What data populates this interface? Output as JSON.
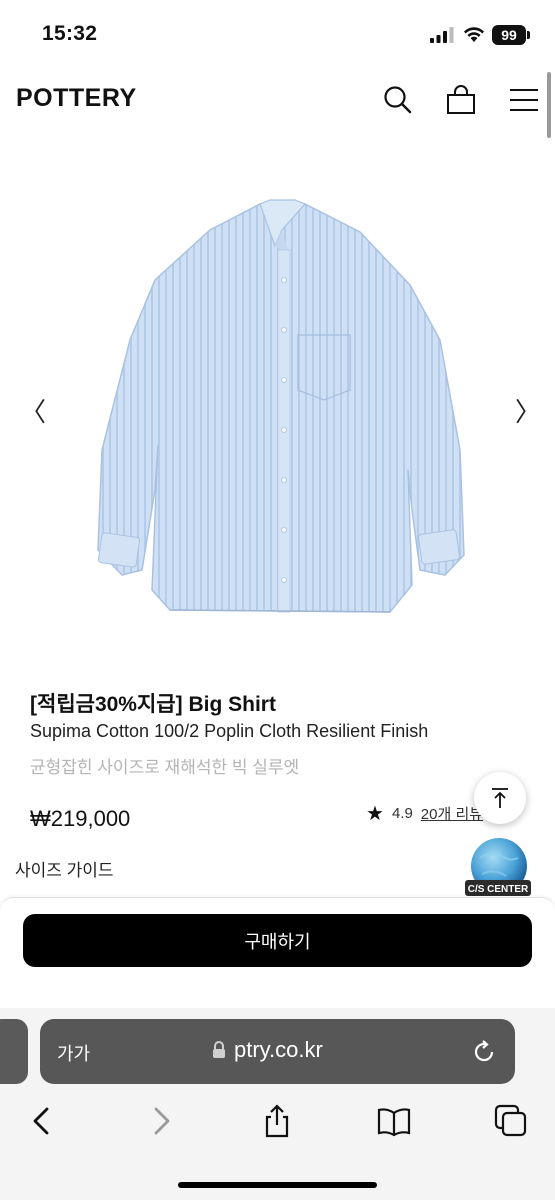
{
  "status_bar": {
    "time": "15:32",
    "battery": "99"
  },
  "header": {
    "logo": "POTTERY"
  },
  "icons": {
    "search": "search-icon",
    "cart": "shopping-bag-icon",
    "menu": "hamburger-menu-icon",
    "prev": "chevron-left-icon",
    "next": "chevron-right-icon",
    "top": "arrow-up-to-top-icon",
    "cs": "cs-center-globe-icon"
  },
  "carousel": {
    "prev_label": "〈",
    "next_label": "〉"
  },
  "product": {
    "title": "[적립금30%지급] Big Shirt",
    "subtitle": "Supima Cotton 100/2 Poplin Cloth Resilient Finish",
    "description": "균형잡힌 사이즈로 재해석한 빅 실루엣",
    "price": "₩219,000",
    "rating": "4.9",
    "reviews": "20개 리뷰"
  },
  "size_guide": "사이즈 가이드",
  "cs_label": "C/S CENTER",
  "buy_button": "구매하기",
  "browser": {
    "aa": "가가",
    "url": "ptry.co.kr"
  },
  "colors": {
    "accent": "#000000",
    "shirt": "#c9ddf3",
    "muted_text": "#b4b4b4"
  }
}
